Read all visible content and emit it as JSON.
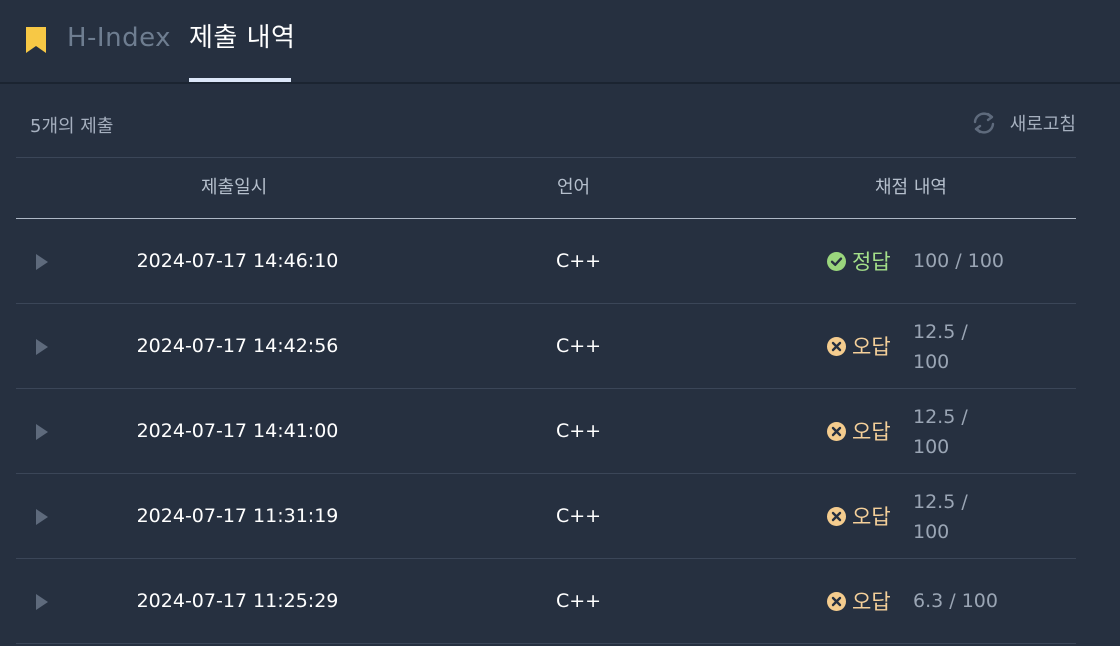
{
  "header": {
    "tabs": [
      {
        "label": "H-Index"
      },
      {
        "label": "제출 내역"
      }
    ]
  },
  "summary": {
    "count_label": "5개의 제출",
    "refresh_label": "새로고침"
  },
  "table": {
    "columns": [
      "제출일시",
      "언어",
      "채점 내역"
    ],
    "rows": [
      {
        "date": "2024-07-17 14:46:10",
        "lang": "C++",
        "verdict": "정답",
        "status": "correct",
        "score_line1": "100 / 100",
        "score_line2": ""
      },
      {
        "date": "2024-07-17 14:42:56",
        "lang": "C++",
        "verdict": "오답",
        "status": "wrong",
        "score_line1": "12.5 /",
        "score_line2": "100"
      },
      {
        "date": "2024-07-17 14:41:00",
        "lang": "C++",
        "verdict": "오답",
        "status": "wrong",
        "score_line1": "12.5 /",
        "score_line2": "100"
      },
      {
        "date": "2024-07-17 11:31:19",
        "lang": "C++",
        "verdict": "오답",
        "status": "wrong",
        "score_line1": "12.5 /",
        "score_line2": "100"
      },
      {
        "date": "2024-07-17 11:25:29",
        "lang": "C++",
        "verdict": "오답",
        "status": "wrong",
        "score_line1": "6.3 / 100",
        "score_line2": ""
      }
    ]
  },
  "icons": {
    "bookmark": "bookmark-icon",
    "refresh": "refresh-icon",
    "expand": "play-icon",
    "correct": "check-circle-icon",
    "wrong": "x-circle-icon"
  },
  "colors": {
    "background": "#263040",
    "accent_bookmark": "#f7c845",
    "correct": "#a4e08a",
    "wrong": "#f5d09a"
  }
}
